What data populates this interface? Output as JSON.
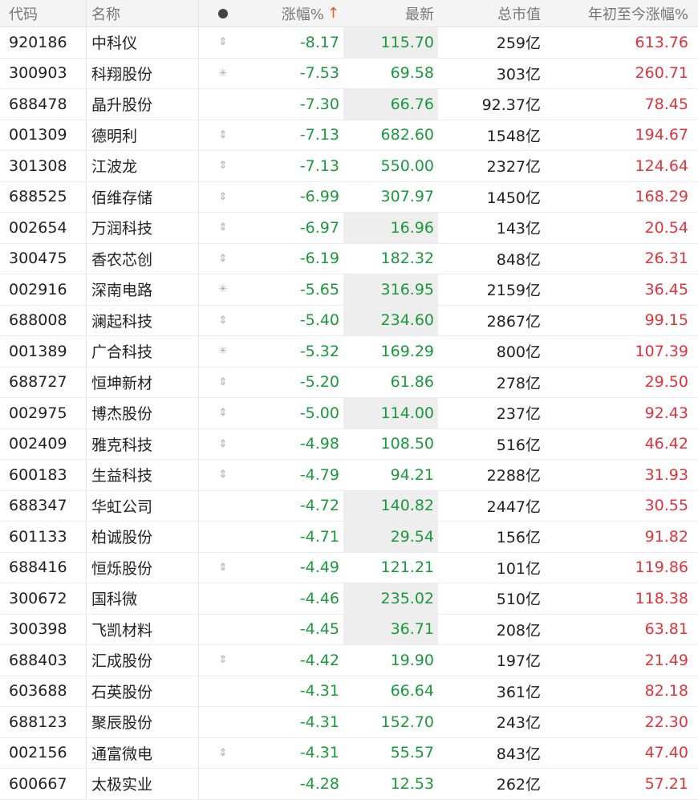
{
  "header": {
    "code": "代码",
    "name": "名称",
    "change_pct": "涨幅%",
    "sort_arrow": "↑",
    "last": "最新",
    "market_cap": "总市值",
    "ytd_change": "年初至今涨幅%"
  },
  "rows": [
    {
      "code": "920186",
      "name": "中科仪",
      "icon": "arrow-icon",
      "change": "-8.17",
      "last": "115.70",
      "highlight": true,
      "mcap": "259亿",
      "ytd": "613.76"
    },
    {
      "code": "300903",
      "name": "科翔股份",
      "icon": "star-icon",
      "change": "-7.53",
      "last": "69.58",
      "highlight": false,
      "mcap": "303亿",
      "ytd": "260.71"
    },
    {
      "code": "688478",
      "name": "晶升股份",
      "icon": "",
      "change": "-7.30",
      "last": "66.76",
      "highlight": true,
      "mcap": "92.37亿",
      "ytd": "78.45"
    },
    {
      "code": "001309",
      "name": "德明利",
      "icon": "arrow-icon",
      "change": "-7.13",
      "last": "682.60",
      "highlight": false,
      "mcap": "1548亿",
      "ytd": "194.67"
    },
    {
      "code": "301308",
      "name": "江波龙",
      "icon": "arrow-icon",
      "change": "-7.13",
      "last": "550.00",
      "highlight": false,
      "mcap": "2327亿",
      "ytd": "124.64"
    },
    {
      "code": "688525",
      "name": "佰维存储",
      "icon": "arrow-icon",
      "change": "-6.99",
      "last": "307.97",
      "highlight": false,
      "mcap": "1450亿",
      "ytd": "168.29"
    },
    {
      "code": "002654",
      "name": "万润科技",
      "icon": "arrow-icon",
      "change": "-6.97",
      "last": "16.96",
      "highlight": true,
      "mcap": "143亿",
      "ytd": "20.54"
    },
    {
      "code": "300475",
      "name": "香农芯创",
      "icon": "arrow-icon",
      "change": "-6.19",
      "last": "182.32",
      "highlight": false,
      "mcap": "848亿",
      "ytd": "26.31"
    },
    {
      "code": "002916",
      "name": "深南电路",
      "icon": "star-icon",
      "change": "-5.65",
      "last": "316.95",
      "highlight": true,
      "mcap": "2159亿",
      "ytd": "36.45"
    },
    {
      "code": "688008",
      "name": "澜起科技",
      "icon": "arrow-icon",
      "change": "-5.40",
      "last": "234.60",
      "highlight": true,
      "mcap": "2867亿",
      "ytd": "99.15"
    },
    {
      "code": "001389",
      "name": "广合科技",
      "icon": "star-icon",
      "change": "-5.32",
      "last": "169.29",
      "highlight": false,
      "mcap": "800亿",
      "ytd": "107.39"
    },
    {
      "code": "688727",
      "name": "恒坤新材",
      "icon": "arrow-icon",
      "change": "-5.20",
      "last": "61.86",
      "highlight": false,
      "mcap": "278亿",
      "ytd": "29.50"
    },
    {
      "code": "002975",
      "name": "博杰股份",
      "icon": "arrow-icon",
      "change": "-5.00",
      "last": "114.00",
      "highlight": true,
      "mcap": "237亿",
      "ytd": "92.43"
    },
    {
      "code": "002409",
      "name": "雅克科技",
      "icon": "arrow-icon",
      "change": "-4.98",
      "last": "108.50",
      "highlight": false,
      "mcap": "516亿",
      "ytd": "46.42"
    },
    {
      "code": "600183",
      "name": "生益科技",
      "icon": "arrow-icon",
      "change": "-4.79",
      "last": "94.21",
      "highlight": false,
      "mcap": "2288亿",
      "ytd": "31.93"
    },
    {
      "code": "688347",
      "name": "华虹公司",
      "icon": "",
      "change": "-4.72",
      "last": "140.82",
      "highlight": true,
      "mcap": "2447亿",
      "ytd": "30.55"
    },
    {
      "code": "601133",
      "name": "柏诚股份",
      "icon": "",
      "change": "-4.71",
      "last": "29.54",
      "highlight": true,
      "mcap": "156亿",
      "ytd": "91.82"
    },
    {
      "code": "688416",
      "name": "恒烁股份",
      "icon": "arrow-icon",
      "change": "-4.49",
      "last": "121.21",
      "highlight": false,
      "mcap": "101亿",
      "ytd": "119.86"
    },
    {
      "code": "300672",
      "name": "国科微",
      "icon": "",
      "change": "-4.46",
      "last": "235.02",
      "highlight": true,
      "mcap": "510亿",
      "ytd": "118.38"
    },
    {
      "code": "300398",
      "name": "飞凯材料",
      "icon": "",
      "change": "-4.45",
      "last": "36.71",
      "highlight": true,
      "mcap": "208亿",
      "ytd": "63.81"
    },
    {
      "code": "688403",
      "name": "汇成股份",
      "icon": "arrow-icon",
      "change": "-4.42",
      "last": "19.90",
      "highlight": false,
      "mcap": "197亿",
      "ytd": "21.49"
    },
    {
      "code": "603688",
      "name": "石英股份",
      "icon": "",
      "change": "-4.31",
      "last": "66.64",
      "highlight": false,
      "mcap": "361亿",
      "ytd": "82.18"
    },
    {
      "code": "688123",
      "name": "聚辰股份",
      "icon": "",
      "change": "-4.31",
      "last": "152.70",
      "highlight": false,
      "mcap": "243亿",
      "ytd": "22.30"
    },
    {
      "code": "002156",
      "name": "通富微电",
      "icon": "arrow-icon",
      "change": "-4.31",
      "last": "55.57",
      "highlight": false,
      "mcap": "843亿",
      "ytd": "47.40"
    },
    {
      "code": "600667",
      "name": "太极实业",
      "icon": "",
      "change": "-4.28",
      "last": "12.53",
      "highlight": false,
      "mcap": "262亿",
      "ytd": "57.21"
    }
  ]
}
